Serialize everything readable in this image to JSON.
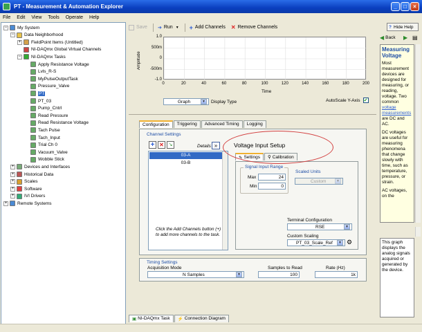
{
  "window": {
    "title": "PT - Measurement & Automation Explorer"
  },
  "menu": [
    "File",
    "Edit",
    "View",
    "Tools",
    "Operate",
    "Help"
  ],
  "tree": [
    {
      "label": "My System",
      "level": 0,
      "icon": "computer-icon"
    },
    {
      "label": "Data Neighborhood",
      "level": 1,
      "icon": "folder-icon"
    },
    {
      "label": "FieldPoint Items (Untitled)",
      "level": 2,
      "icon": "fieldpoint-icon"
    },
    {
      "label": "NI-DAQmx Global Virtual Channels",
      "level": 2,
      "icon": "channels-icon"
    },
    {
      "label": "NI-DAQmx Tasks",
      "level": 2,
      "icon": "tasks-icon"
    },
    {
      "label": "Apply Resistance Voltage",
      "level": 3,
      "icon": "task-icon"
    },
    {
      "label": "Lvls_R-S",
      "level": 3,
      "icon": "task-icon"
    },
    {
      "label": "MyPulseOutputTask",
      "level": 3,
      "icon": "task-icon"
    },
    {
      "label": "Pressure_Valve",
      "level": 3,
      "icon": "task-icon"
    },
    {
      "label": "PT",
      "level": 3,
      "icon": "task-icon",
      "selected": true
    },
    {
      "label": "PT_03",
      "level": 3,
      "icon": "task-icon"
    },
    {
      "label": "Pump_Cntrl",
      "level": 3,
      "icon": "task-icon"
    },
    {
      "label": "Read Pressure",
      "level": 3,
      "icon": "task-icon"
    },
    {
      "label": "Read Resistance Voltage",
      "level": 3,
      "icon": "task-icon"
    },
    {
      "label": "Tach Pulse",
      "level": 3,
      "icon": "task-icon"
    },
    {
      "label": "Tach_Input",
      "level": 3,
      "icon": "task-icon"
    },
    {
      "label": "Trial Ch 0",
      "level": 3,
      "icon": "task-icon"
    },
    {
      "label": "Vacuum_Valve",
      "level": 3,
      "icon": "task-icon"
    },
    {
      "label": "Wobble Stick",
      "level": 3,
      "icon": "task-icon"
    },
    {
      "label": "Devices and Interfaces",
      "level": 1,
      "icon": "devices-icon"
    },
    {
      "label": "Historical Data",
      "level": 1,
      "icon": "historical-icon"
    },
    {
      "label": "Scales",
      "level": 1,
      "icon": "scales-icon"
    },
    {
      "label": "Software",
      "level": 1,
      "icon": "software-icon"
    },
    {
      "label": "IVI Drivers",
      "level": 1,
      "icon": "ivi-icon"
    },
    {
      "label": "Remote Systems",
      "level": 0,
      "icon": "remote-icon"
    }
  ],
  "toolbar": {
    "save": "Save",
    "run": "Run",
    "add_channels": "Add Channels",
    "remove_channels": "Remove Channels",
    "hide_help": "Hide Help"
  },
  "graph": {
    "y_ticks": [
      "1.0",
      "500m",
      "0",
      "-500m",
      "-1.0"
    ],
    "x_ticks": [
      "0",
      "20",
      "40",
      "60",
      "80",
      "100",
      "120",
      "140",
      "160",
      "180",
      "200"
    ],
    "ylabel": "Amplitude",
    "xlabel": "Time",
    "display_type_value": "Graph",
    "display_type_label": "Display Type",
    "autoscale_label": "AutoScale Y-Axis"
  },
  "config_tabs": [
    "Configuration",
    "Triggering",
    "Advanced Timing",
    "Logging"
  ],
  "channel_settings": {
    "label": "Channel Settings",
    "details": "Details",
    "channels": [
      "03-A",
      "03-B"
    ],
    "hint": "Click the Add Channels button (+) to add more channels to the task."
  },
  "voltage_setup": {
    "title": "Voltage Input Setup",
    "tabs": [
      "Settings",
      "Calibration"
    ],
    "signal_range_label": "Signal Input Range",
    "max_label": "Max",
    "max_value": "24",
    "min_label": "Min",
    "min_value": "0",
    "scaled_units_label": "Scaled Units",
    "scaled_units_value": "Custom",
    "terminal_config_label": "Terminal Configuration",
    "terminal_config_value": "RSE",
    "custom_scaling_label": "Custom Scaling",
    "custom_scaling_value": "PT_03_Scale_Ref"
  },
  "timing": {
    "label": "Timing Settings",
    "acq_mode_label": "Acquisition Mode",
    "acq_mode_value": "N Samples",
    "samples_label": "Samples to Read",
    "samples_value": "100",
    "rate_label": "Rate (Hz)",
    "rate_value": "1k"
  },
  "bottom_tabs": [
    "NI-DAQmx Task",
    "Connection Diagram"
  ],
  "help": {
    "back": "Back",
    "title": "Measuring Voltage",
    "body": "Most measurement devices are designed for measuring, or reading, voltage. Two common ",
    "link": "voltage measurements",
    "body2": " are DC and AC.",
    "body3": "DC voltages are useful for measuring phenomena that change slowly with time, such as temperature, pressure, or strain.",
    "body4": "AC voltages, on the",
    "lower": "This graph displays the analog signals acquired or generated by the device."
  },
  "colors": {
    "title_blue": "#0a3fbf",
    "selection": "#316ac5",
    "group_label": "#1c4ca5",
    "annotation": "#d23c3c"
  }
}
